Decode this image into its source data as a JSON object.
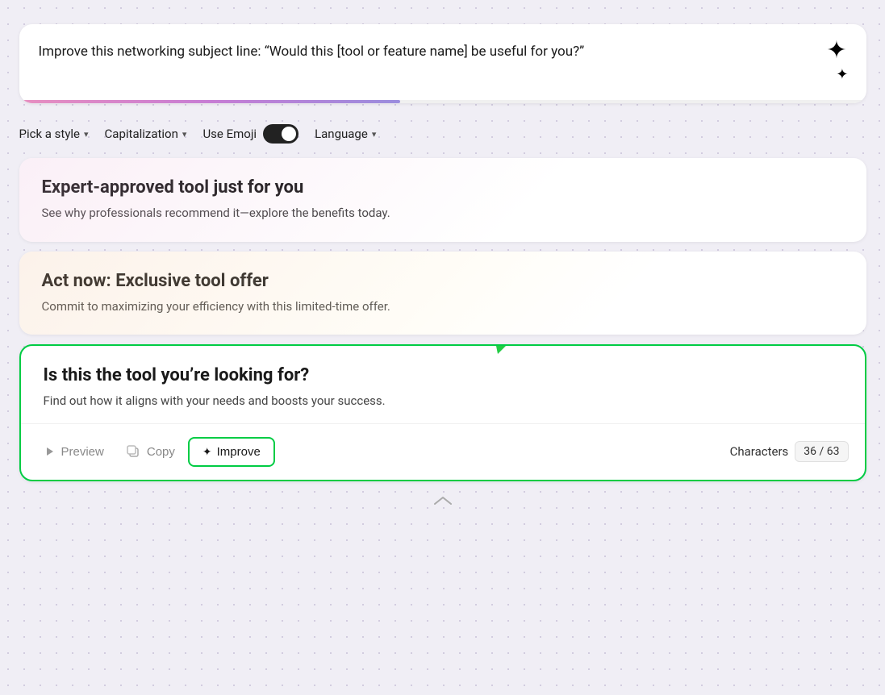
{
  "page": {
    "background": "#f0eef5"
  },
  "input_card": {
    "text": "Improve this networking subject line: “Would this [tool or feature name] be useful for you?”",
    "sparkle_symbol": "✦✦",
    "progress_percent": 45
  },
  "toolbar": {
    "style_label": "Pick a style",
    "capitalization_label": "Capitalization",
    "emoji_label": "Use Emoji",
    "emoji_enabled": true,
    "language_label": "Language"
  },
  "result_cards": [
    {
      "id": "card1",
      "title": "Expert-approved tool just for you",
      "subtitle": "See why professionals recommend it—explore the benefits today.",
      "style": "pink"
    },
    {
      "id": "card2",
      "title": "Act now: Exclusive tool offer",
      "subtitle": "Commit to maximizing your efficiency with this limited-time offer.",
      "style": "peach"
    },
    {
      "id": "card3",
      "title": "Is this the tool you’re looking for?",
      "subtitle": "Find out how it aligns with your needs and boosts your success.",
      "style": "active"
    }
  ],
  "action_bar": {
    "preview_label": "Preview",
    "copy_label": "Copy",
    "improve_label": "Improve",
    "characters_label": "Characters",
    "char_current": "36",
    "char_max": "63",
    "char_display": "36 / 63"
  }
}
